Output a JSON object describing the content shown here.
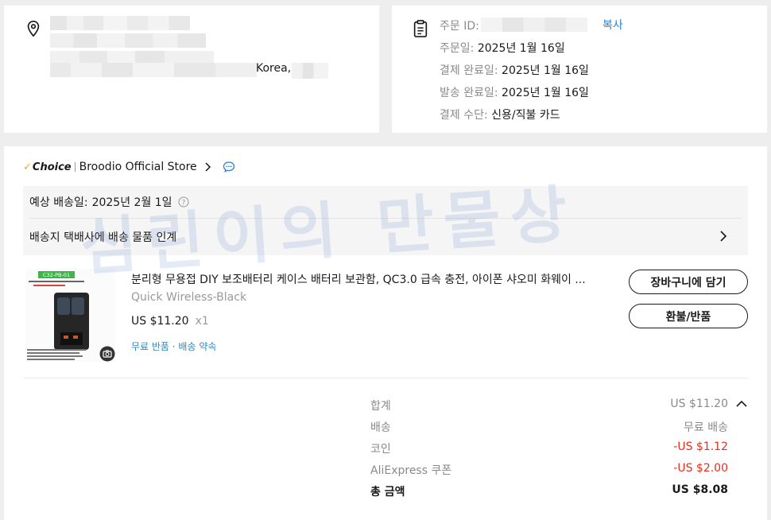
{
  "address": {
    "country": "Korea,"
  },
  "order": {
    "id_label": "주문 ID:",
    "copy_label": "복사",
    "order_date_label": "주문일:",
    "order_date_value": "2025년 1월 16일",
    "payment_done_label": "결제 완료일:",
    "payment_done_value": "2025년 1월 16일",
    "shipped_label": "발송 완료일:",
    "shipped_value": "2025년 1월 16일",
    "payment_method_label": "결제 수단:",
    "payment_method_value": "신용/직불 카드"
  },
  "store": {
    "choice_label": "Choice",
    "name": "Broodio Official Store"
  },
  "shipping": {
    "estimate_label": "예상 배송일:",
    "estimate_value": "2025년 2월 1일",
    "pickup_text": "배송지 택배사에 배송 물품 인계"
  },
  "product": {
    "title": "분리형 무용접 DIY 보조배터리 케이스 배터리 보관함, QC3.0 급속 충전, 아이폰 샤오미 화웨이 ...",
    "variant": "Quick Wireless-Black",
    "price": "US $11.20",
    "quantity": "x1",
    "promise": "무료 반품 · 배송 약속",
    "image_badge": "C32-PB-01"
  },
  "buttons": {
    "add_to_cart": "장바구니에 담기",
    "refund": "환불/반품"
  },
  "summary": {
    "subtotal_label": "합계",
    "subtotal_value": "US $11.20",
    "shipping_label": "배송",
    "shipping_value": "무료 배송",
    "coin_label": "코인",
    "coin_value": "-US $1.12",
    "coupon_label": "AliExpress 쿠폰",
    "coupon_value": "-US $2.00",
    "total_label": "총 금액",
    "total_value": "US $8.08"
  },
  "watermark": "심린이의 만물상",
  "colors": {
    "link_blue": "#2a7ee0",
    "discount_red": "#e52f1e",
    "choice_yellow": "#f5a623"
  }
}
